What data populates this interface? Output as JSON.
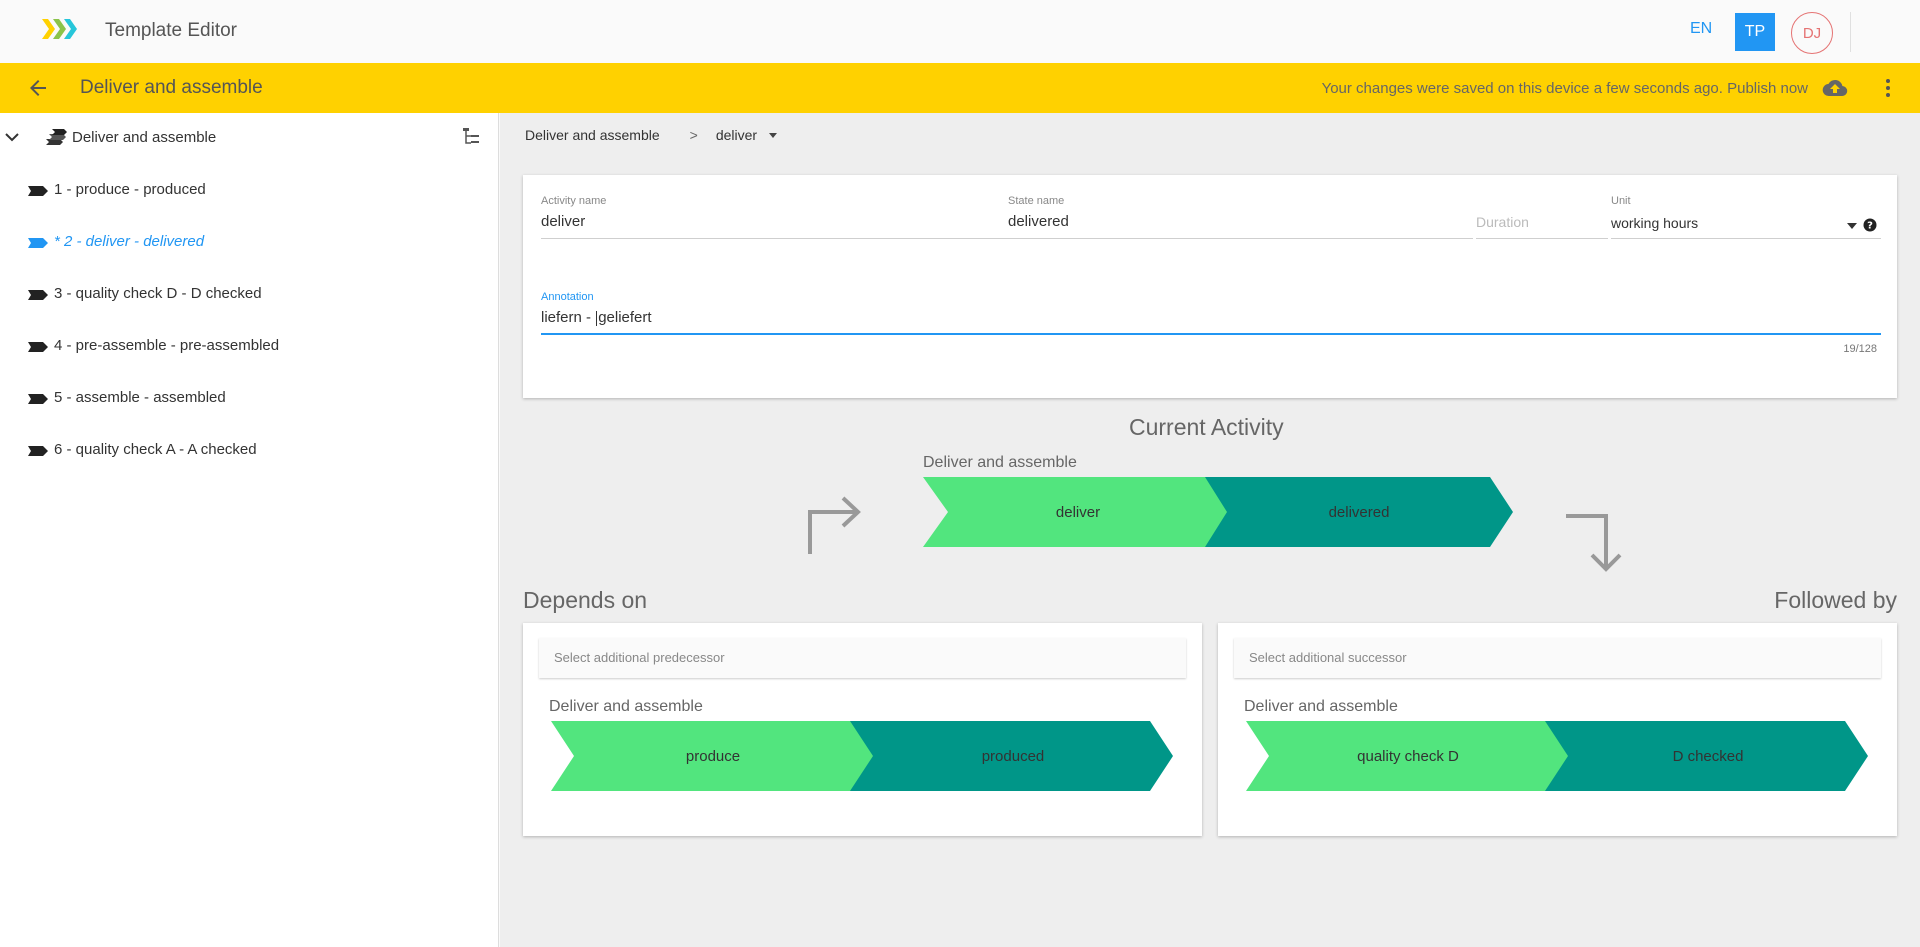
{
  "app": {
    "title": "Template Editor"
  },
  "header": {
    "lang": "EN",
    "badge": "TP",
    "avatar_initials": "DJ"
  },
  "toolbar": {
    "title": "Deliver and assemble",
    "save_status": "Your changes were saved on this device a few seconds ago. Publish now"
  },
  "sidebar": {
    "root_label": "Deliver and assemble",
    "items": [
      {
        "label": "1 - produce - produced"
      },
      {
        "label": "* 2 - deliver - delivered"
      },
      {
        "label": "3 - quality check D - D checked"
      },
      {
        "label": "4 - pre-assemble - pre-assembled"
      },
      {
        "label": "5 - assemble - assembled"
      },
      {
        "label": "6 - quality check A - A checked"
      }
    ],
    "active_index": 1
  },
  "breadcrumb": {
    "root": "Deliver and assemble",
    "sep": ">",
    "current": "deliver"
  },
  "form": {
    "activity_label": "Activity name",
    "activity_value": "deliver",
    "state_label": "State name",
    "state_value": "delivered",
    "duration_placeholder": "Duration",
    "unit_label": "Unit",
    "unit_value": "working hours",
    "annotation_label": "Annotation",
    "annotation_before": "liefern - ",
    "annotation_after": "geliefert",
    "counter": "19/128"
  },
  "current": {
    "title": "Current Activity",
    "process": "Deliver and assemble",
    "activity": "deliver",
    "state": "delivered"
  },
  "depends": {
    "title": "Depends on",
    "select_placeholder": "Select additional predecessor",
    "process": "Deliver and assemble",
    "activity": "produce",
    "state": "produced"
  },
  "followed": {
    "title": "Followed by",
    "select_placeholder": "Select additional successor",
    "process": "Deliver and assemble",
    "activity": "quality check D",
    "state": "D checked"
  },
  "colors": {
    "yellow": "#ffd100",
    "blue": "#2196f3",
    "light_green": "#52e57e",
    "teal": "#009688"
  }
}
